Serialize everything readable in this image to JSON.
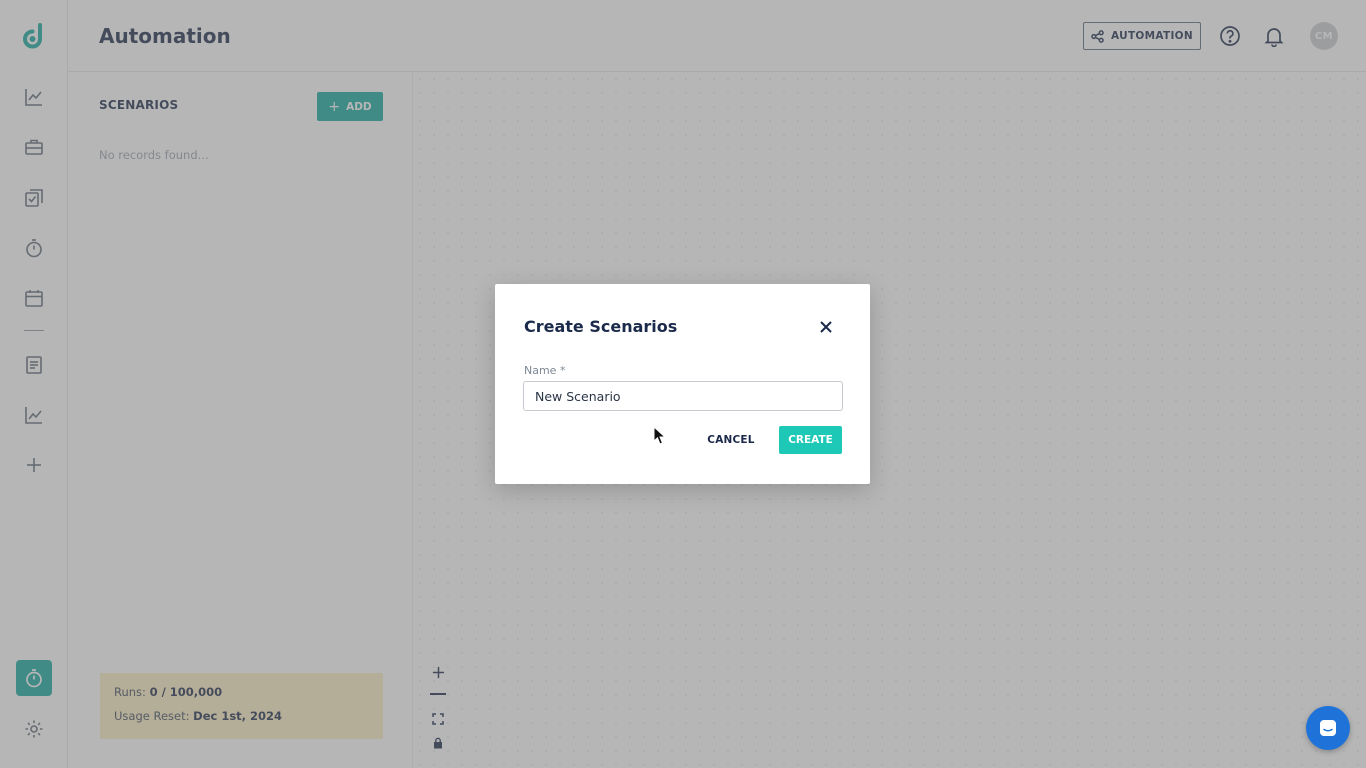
{
  "header": {
    "title": "Automation",
    "automation_button": "AUTOMATION",
    "avatar_initials": "CM"
  },
  "sidebar": {
    "items": [
      {
        "icon": "trend-chart-icon"
      },
      {
        "icon": "briefcase-icon"
      },
      {
        "icon": "tasks-check-icon"
      },
      {
        "icon": "stopwatch-icon"
      },
      {
        "icon": "calendar-icon"
      },
      {
        "icon": "document-icon"
      },
      {
        "icon": "analytics-icon"
      },
      {
        "icon": "plus-icon"
      }
    ],
    "active_icon": "stopwatch-icon",
    "settings_icon": "gear-icon"
  },
  "scenarios": {
    "title": "SCENARIOS",
    "add_label": "ADD",
    "empty_text": "No records found..."
  },
  "usage": {
    "runs_label": "Runs:",
    "runs_value": "0 / 100,000",
    "reset_label": "Usage Reset:",
    "reset_value": "Dec 1st, 2024"
  },
  "modal": {
    "title": "Create Scenarios",
    "name_label": "Name *",
    "name_value": "New Scenario",
    "cancel_label": "CANCEL",
    "create_label": "CREATE"
  },
  "colors": {
    "brand": "#13a89e",
    "create_button": "#1ec8b6",
    "chat_button": "#1f73d8",
    "usage_box": "#fbecc2"
  }
}
